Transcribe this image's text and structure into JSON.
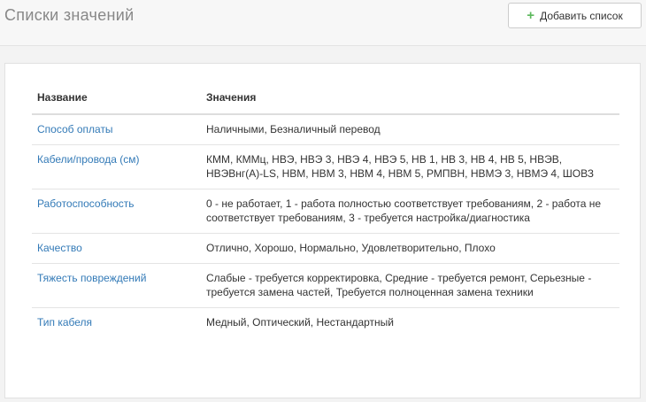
{
  "header": {
    "title": "Списки значений",
    "add_button_label": "Добавить список"
  },
  "table": {
    "columns": [
      "Название",
      "Значения"
    ],
    "rows": [
      {
        "name": "Способ оплаты",
        "values": "Наличными, Безналичный перевод"
      },
      {
        "name": "Кабели/провода (см)",
        "values": "КММ, КММц, НВЭ, НВЭ 3, НВЭ 4, НВЭ 5, НВ 1, НВ 3, НВ 4, НВ 5, НВЭВ, НВЭВнг(А)-LS, НВМ, НВМ 3, НВМ 4, НВМ 5, РМПВН, НВМЭ 3, НВМЭ 4, ШОВЗ"
      },
      {
        "name": "Работоспособность",
        "values": "0 - не работает, 1 - работа полностью соответствует требованиям, 2 - работа не соответствует требованиям, 3 - требуется настройка/диагностика"
      },
      {
        "name": "Качество",
        "values": "Отлично, Хорошо, Нормально, Удовлетворительно, Плохо"
      },
      {
        "name": "Тяжесть повреждений",
        "values": "Слабые - требуется корректировка, Средние - требуется ремонт, Серьезные - требуется замена частей, Требуется полноценная замена техники"
      },
      {
        "name": "Тип кабеля",
        "values": "Медный, Оптический, Нестандартный"
      }
    ]
  },
  "colors": {
    "link": "#337ab7",
    "accent_plus": "#5cb85c",
    "title_gray": "#888888"
  },
  "icons": {
    "add": "plus-icon"
  }
}
